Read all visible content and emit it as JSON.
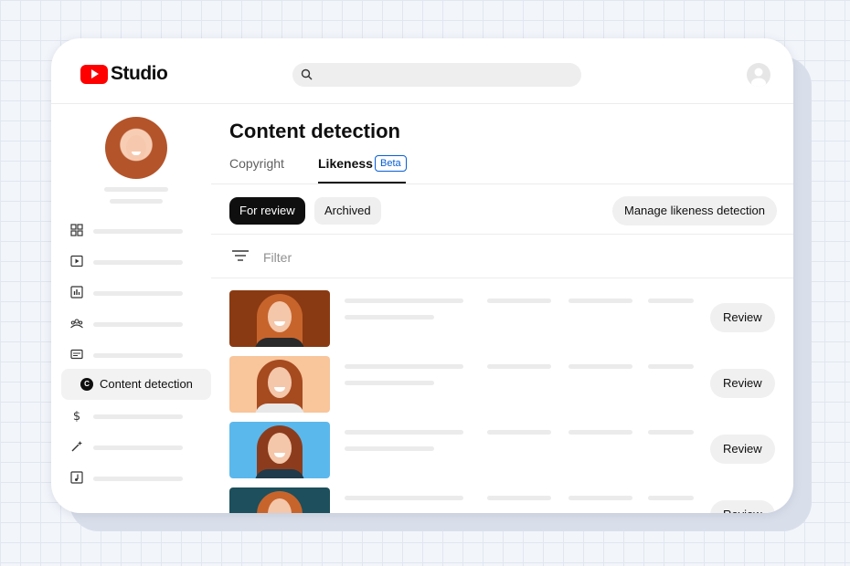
{
  "app": {
    "name": "Studio",
    "logo_icon": "youtube-play-icon"
  },
  "header": {
    "search_icon": "search-icon",
    "account_icon": "account-circle-icon"
  },
  "sidebar": {
    "items": [
      {
        "icon": "dashboard-icon",
        "label": ""
      },
      {
        "icon": "content-icon",
        "label": ""
      },
      {
        "icon": "analytics-icon",
        "label": ""
      },
      {
        "icon": "community-icon",
        "label": ""
      },
      {
        "icon": "subtitles-icon",
        "label": ""
      },
      {
        "icon": "content-detection-icon",
        "label": "Content detection",
        "active": true,
        "badge": "C"
      },
      {
        "icon": "earn-icon",
        "label": ""
      },
      {
        "icon": "customization-icon",
        "label": ""
      },
      {
        "icon": "audio-library-icon",
        "label": ""
      }
    ]
  },
  "main": {
    "title": "Content detection",
    "tabs": [
      {
        "label": "Copyright",
        "active": false
      },
      {
        "label": "Likeness",
        "active": true,
        "badge": "Beta"
      }
    ],
    "chips": [
      {
        "label": "For review",
        "selected": true
      },
      {
        "label": "Archived",
        "selected": false
      }
    ],
    "manage_button": "Manage likeness detection",
    "filter": {
      "icon": "filter-icon",
      "placeholder": "Filter"
    },
    "rows": [
      {
        "thumb_bg": "#8a3a12",
        "action": "Review"
      },
      {
        "thumb_bg": "#f9c59b",
        "action": "Review"
      },
      {
        "thumb_bg": "#5bb8ec",
        "action": "Review"
      },
      {
        "thumb_bg": "#1d4f5c",
        "action": "Review"
      }
    ]
  },
  "colors": {
    "brand_red": "#ff0000",
    "beta_blue": "#065fd4",
    "chip_selected": "#0f0f0f"
  }
}
